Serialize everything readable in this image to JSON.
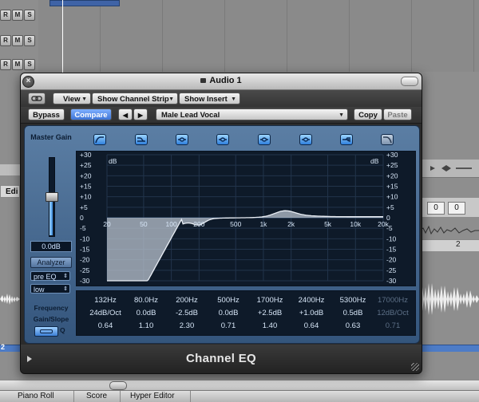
{
  "window": {
    "title": "Audio 1",
    "plugin_name": "Channel EQ"
  },
  "toolbar": {
    "view_label": "View",
    "show_channel_strip_label": "Show Channel Strip",
    "show_insert_label": "Show Insert",
    "bypass_label": "Bypass",
    "compare_label": "Compare",
    "preset_name": "Male Lead Vocal",
    "copy_label": "Copy",
    "paste_label": "Paste",
    "prev_label": "◀",
    "next_label": "▶"
  },
  "left_panel": {
    "master_gain_label": "Master Gain",
    "master_gain_value": "0.0dB",
    "master_gain_level": 0.5,
    "analyzer_label": "Analyzer",
    "pre_eq_value": "pre EQ",
    "resolution_value": "low",
    "frequency_label": "Frequency",
    "gain_slope_label": "Gain/Slope",
    "q_label": "Q"
  },
  "graph": {
    "db_label_left": "dB",
    "db_label_right": "dB",
    "db_ticks": [
      "+30",
      "+25",
      "+20",
      "+15",
      "+10",
      "+5",
      "0",
      "-5",
      "-10",
      "-15",
      "-20",
      "-25",
      "-30"
    ],
    "freq_ticks": [
      "20",
      "50",
      "100",
      "200",
      "500",
      "1k",
      "2k",
      "5k",
      "10k",
      "20k"
    ]
  },
  "bands": [
    {
      "icon": "high-pass-icon",
      "freq": "132Hz",
      "gain": "24dB/Oct",
      "q": "0.64",
      "active": true
    },
    {
      "icon": "low-shelf-icon",
      "freq": "80.0Hz",
      "gain": "0.0dB",
      "q": "1.10",
      "active": true
    },
    {
      "icon": "bell-icon",
      "freq": "200Hz",
      "gain": "-2.5dB",
      "q": "2.30",
      "active": true
    },
    {
      "icon": "bell-icon",
      "freq": "500Hz",
      "gain": "0.0dB",
      "q": "0.71",
      "active": true
    },
    {
      "icon": "bell-icon",
      "freq": "1700Hz",
      "gain": "+2.5dB",
      "q": "1.40",
      "active": true
    },
    {
      "icon": "bell-icon",
      "freq": "2400Hz",
      "gain": "+1.0dB",
      "q": "0.64",
      "active": true
    },
    {
      "icon": "high-shelf-icon",
      "freq": "5300Hz",
      "gain": "0.5dB",
      "q": "0.63",
      "active": true
    },
    {
      "icon": "low-pass-icon",
      "freq": "17000Hz",
      "gain": "12dB/Oct",
      "q": "0.71",
      "active": false
    }
  ],
  "host": {
    "track_buttons": [
      "R",
      "M",
      "S"
    ],
    "edit_tab": "Edi",
    "counter_a": "0",
    "counter_b": "0",
    "ruler_mark": "2",
    "bar_number": "2",
    "bottom_tabs": [
      "Piano Roll",
      "Score",
      "Hyper Editor"
    ]
  }
}
